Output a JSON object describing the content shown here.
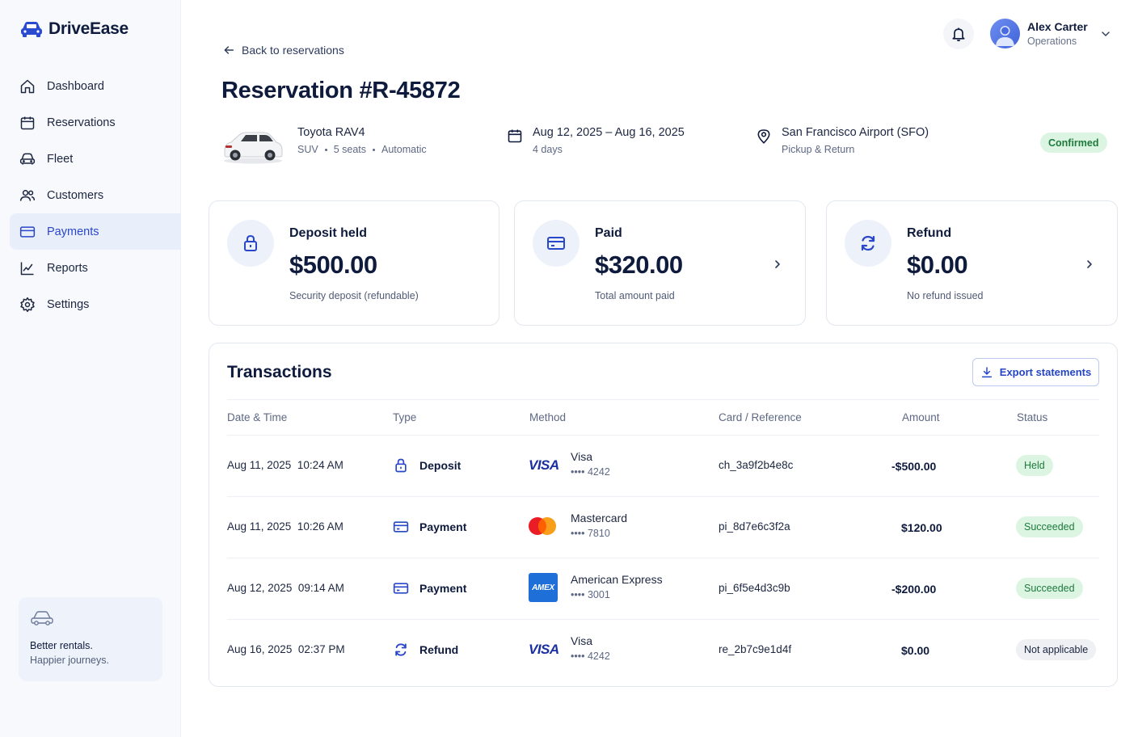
{
  "brand": {
    "name": "DriveEase"
  },
  "sidebar": {
    "items": [
      {
        "label": "Dashboard",
        "icon": "home-icon"
      },
      {
        "label": "Reservations",
        "icon": "calendar-icon"
      },
      {
        "label": "Fleet",
        "icon": "car-icon"
      },
      {
        "label": "Customers",
        "icon": "users-icon"
      },
      {
        "label": "Payments",
        "icon": "credit-card-icon",
        "active": true
      },
      {
        "label": "Reports",
        "icon": "chart-icon"
      },
      {
        "label": "Settings",
        "icon": "gear-icon"
      }
    ],
    "promo": {
      "title": "Better rentals.",
      "subtitle": "Happier journeys."
    }
  },
  "header": {
    "user": {
      "name": "Alex Carter",
      "role": "Operations"
    }
  },
  "back_link": "Back to reservations",
  "page_title": "Reservation #R-45872",
  "summary": {
    "vehicle": {
      "name": "Toyota RAV4",
      "class": "SUV",
      "seats": "5 seats",
      "transmission": "Automatic"
    },
    "dates": {
      "range": "Aug 12, 2025 – Aug 16, 2025",
      "duration": "4 days"
    },
    "location": {
      "name": "San Francisco Airport (SFO)",
      "detail": "Pickup & Return"
    },
    "status": "Confirmed"
  },
  "cards": [
    {
      "title": "Deposit held",
      "amount": "$500.00",
      "note": "Security deposit (refundable)",
      "icon": "lock-icon"
    },
    {
      "title": "Paid",
      "amount": "$320.00",
      "note": "Total amount paid",
      "icon": "credit-card-icon"
    },
    {
      "title": "Refund",
      "amount": "$0.00",
      "note": "No refund issued",
      "icon": "refresh-icon"
    }
  ],
  "transactions": {
    "title": "Transactions",
    "export_label": "Export statements",
    "columns": [
      "Date & Time",
      "Type",
      "Method",
      "Card / Reference",
      "Amount",
      "Status"
    ],
    "rows": [
      {
        "date": "Aug 11, 2025",
        "time": "10:24 AM",
        "type": "Deposit",
        "method": "Visa",
        "last4": "•••• 4242",
        "reference": "ch_3a9f2b4e8c",
        "amount": "-$500.00",
        "status": "Held"
      },
      {
        "date": "Aug 11, 2025",
        "time": "10:26 AM",
        "type": "Payment",
        "method": "Mastercard",
        "last4": "•••• 7810",
        "reference": "pi_8d7e6c3f2a",
        "amount": "$120.00",
        "status": "Succeeded"
      },
      {
        "date": "Aug 12, 2025",
        "time": "09:14 AM",
        "type": "Payment",
        "method": "American Express",
        "last4": "•••• 3001",
        "reference": "pi_6f5e4d3c9b",
        "amount": "-$200.00",
        "status": "Succeeded"
      },
      {
        "date": "Aug 16, 2025",
        "time": "02:37 PM",
        "type": "Refund",
        "method": "Visa",
        "last4": "•••• 4242",
        "reference": "re_2b7c9e1d4f",
        "amount": "$0.00",
        "status": "Not applicable"
      }
    ],
    "brand_marks": {
      "visa": "VISA",
      "amex": "AMEX"
    }
  },
  "colors": {
    "accent": "#2947c8",
    "success_bg": "#dcf5e3",
    "success_text": "#1e7a3c"
  }
}
